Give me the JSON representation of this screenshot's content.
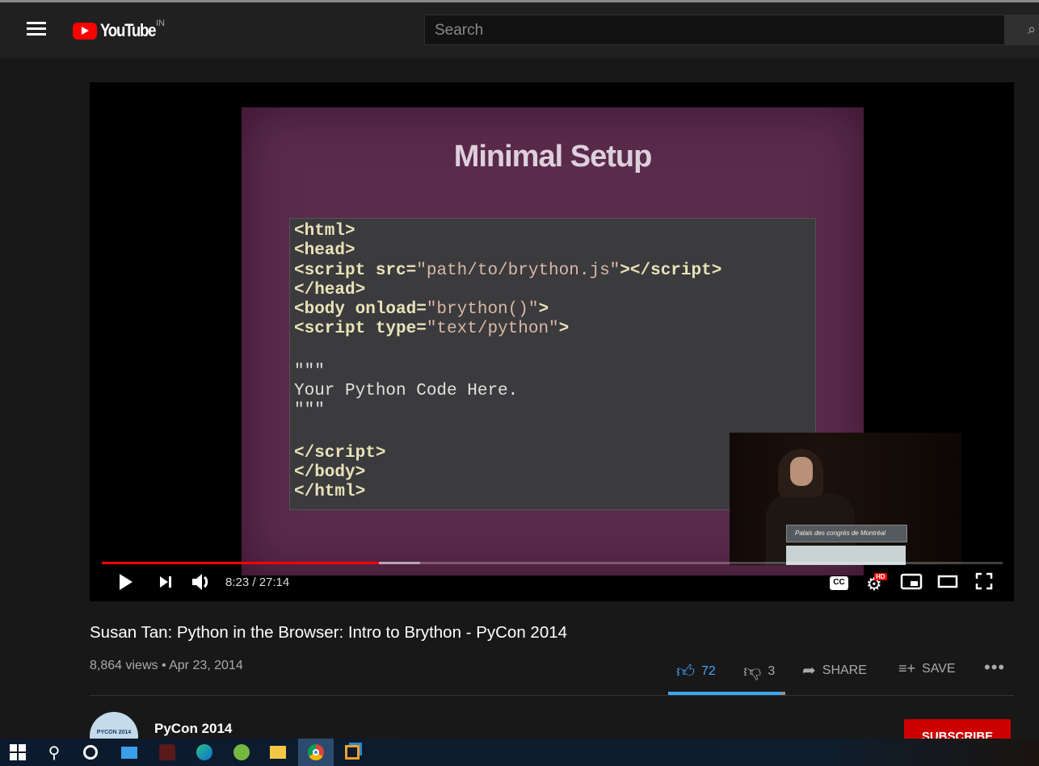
{
  "header": {
    "logo_text": "YouTube",
    "country_code": "IN",
    "search_placeholder": "Search"
  },
  "player": {
    "slide_title": "Minimal Setup",
    "code_lines": [
      "<html>",
      "<head>",
      "<script src=\"path/to/brython.js\"></script>",
      "</head>",
      "<body onload=\"brython()\">",
      "<script type=\"text/python\">",
      "",
      "\"\"\"",
      "Your Python Code Here.",
      "\"\"\"",
      "",
      "</script>",
      "</body>",
      "</html>"
    ],
    "podium_text": "Palais des congrès de Montréal",
    "current_time": "8:23",
    "duration": "27:14",
    "time_display": "8:23 / 27:14",
    "progress_fraction": 0.308,
    "buffered_fraction": 0.353,
    "hd_badge": "HD",
    "cc_label": "CC"
  },
  "video": {
    "title": "Susan Tan: Python in the Browser: Intro to Brython - PyCon 2014",
    "views": "8,864 views",
    "date": "Apr 23, 2014",
    "meta": "8,864 views • Apr 23, 2014",
    "likes": "72",
    "dislikes": "3",
    "share_label": "SHARE",
    "save_label": "SAVE",
    "like_ratio": 0.96
  },
  "channel": {
    "name": "PyCon 2014",
    "avatar_text": "PYCON 2014",
    "subscribe_label": "SUBSCRIBE"
  },
  "taskbar": {
    "icons": [
      "windows-start",
      "search",
      "cortana",
      "mail",
      "predator",
      "edge",
      "utorrent",
      "file-explorer",
      "chrome",
      "virtualbox"
    ]
  },
  "colors": {
    "accent_red": "#ff0000",
    "like_blue": "#3ea6ff",
    "subscribe": "#cc0000"
  }
}
